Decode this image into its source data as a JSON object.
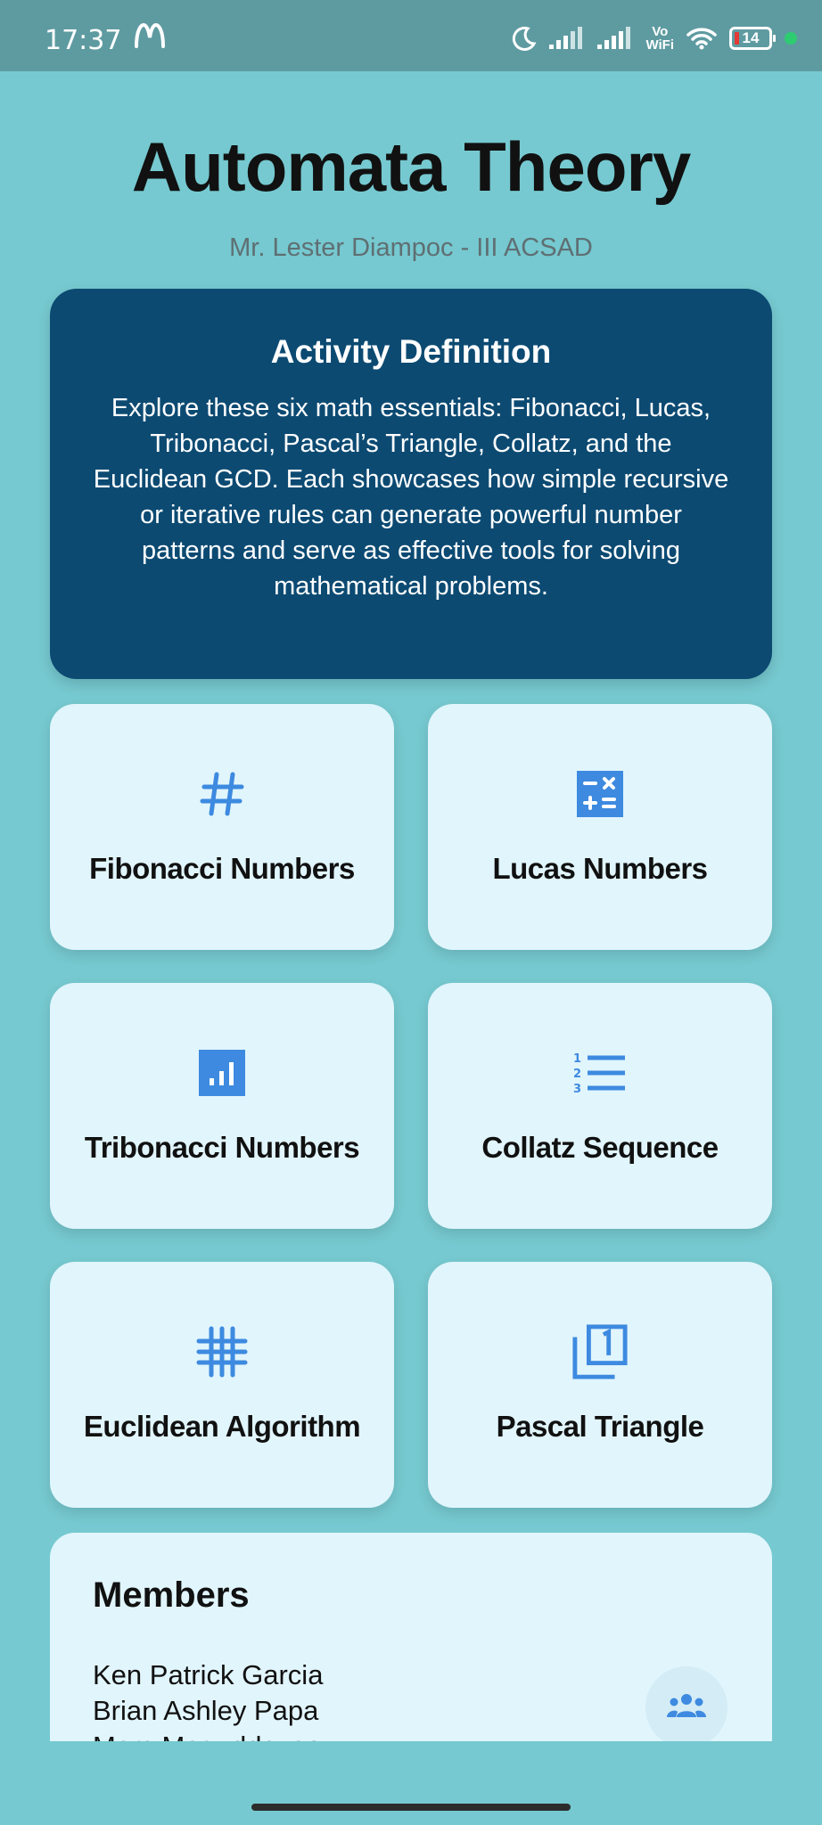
{
  "status_bar": {
    "time": "17:37",
    "carrier_icon": "m-logo",
    "vo_wifi": "Vo\nWiFi",
    "battery": "14"
  },
  "header": {
    "title": "Automata Theory",
    "subtitle": "Mr. Lester Diampoc - III ACSAD"
  },
  "definition": {
    "title": "Activity Definition",
    "body": "Explore these six math essentials: Fibonacci, Lucas, Tribonacci, Pascal’s Triangle, Collatz, and the Euclidean GCD. Each showcases how simple recursive or iterative rules can generate powerful number patterns and serve as effective tools for solving mathematical problems."
  },
  "tiles": [
    {
      "label": "Fibonacci Numbers",
      "icon": "hash-icon"
    },
    {
      "label": "Lucas Numbers",
      "icon": "calculator-icon"
    },
    {
      "label": "Tribonacci Numbers",
      "icon": "bar-chart-icon"
    },
    {
      "label": "Collatz Sequence",
      "icon": "numbered-list-icon"
    },
    {
      "label": "Euclidean Algorithm",
      "icon": "grid-icon"
    },
    {
      "label": "Pascal Triangle",
      "icon": "filter-1-icon"
    }
  ],
  "members": {
    "title": "Members",
    "names": [
      "Ken Patrick Garcia",
      "Brian Ashley Papa",
      "Marc Maguddayao"
    ]
  },
  "colors": {
    "background": "#76c9d0",
    "status_bar": "#5e9ba1",
    "definition_card": "#0c4a72",
    "tile": "#e1f5fc",
    "icon_accent": "#3d8ae0"
  }
}
